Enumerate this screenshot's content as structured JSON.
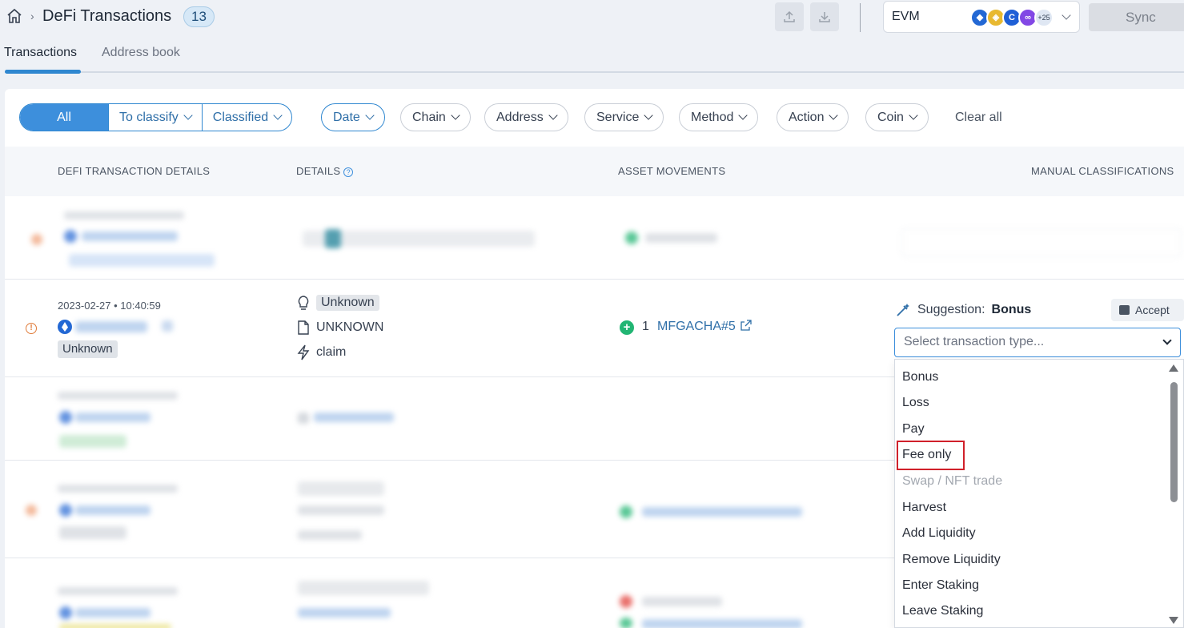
{
  "header": {
    "title": "DeFi Transactions",
    "count": "13",
    "chain_selector": {
      "value": "EVM",
      "more_chains": "+25"
    },
    "sync_label": "Sync"
  },
  "tabs": [
    {
      "label": "Transactions",
      "active": true
    },
    {
      "label": "Address book",
      "active": false
    }
  ],
  "filters": {
    "segments": [
      "All",
      "To classify",
      "Classified"
    ],
    "dropdowns": [
      "Date",
      "Chain",
      "Address",
      "Service",
      "Method",
      "Action",
      "Coin"
    ],
    "clear_all": "Clear all"
  },
  "table": {
    "columns": [
      "DEFI TRANSACTION DETAILS",
      "DETAILS",
      "ASSET MOVEMENTS",
      "MANUAL CLASSIFICATIONS"
    ],
    "focused_row": {
      "date": "2023-02-27 • 10:40:59",
      "status": "Unknown",
      "service": "Unknown",
      "method": "UNKNOWN",
      "action": "claim",
      "amount": "1",
      "asset": "MFGACHA#5",
      "suggestion_label": "Suggestion:",
      "suggestion_value": "Bonus",
      "accept_label": "Accept",
      "select_placeholder": "Select transaction type..."
    }
  },
  "dropdown_options": [
    {
      "label": "Bonus",
      "disabled": false
    },
    {
      "label": "Loss",
      "disabled": false
    },
    {
      "label": "Pay",
      "disabled": false
    },
    {
      "label": "Fee only",
      "disabled": false,
      "highlighted": true
    },
    {
      "label": "Swap / NFT trade",
      "disabled": true
    },
    {
      "label": "Harvest",
      "disabled": false
    },
    {
      "label": "Add Liquidity",
      "disabled": false
    },
    {
      "label": "Remove Liquidity",
      "disabled": false
    },
    {
      "label": "Enter Staking",
      "disabled": false
    },
    {
      "label": "Leave Staking",
      "disabled": false
    }
  ],
  "colors": {
    "accent": "#3d8fdc",
    "highlight_border": "#d0202a",
    "warning": "#e07b39",
    "success": "#22b573"
  }
}
